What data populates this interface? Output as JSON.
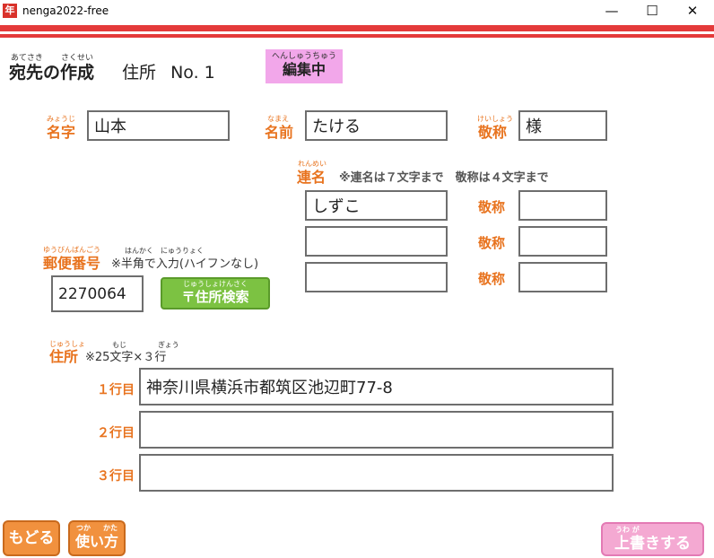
{
  "window": {
    "app_icon_text": "年",
    "title": "nenga2022-free",
    "minimize": "—",
    "maximize": "☐",
    "close": "✕"
  },
  "header": {
    "title": "宛先の作成",
    "title_ruby_1": "あてさき",
    "title_ruby_2": "さくせい",
    "address_label": "住所",
    "address_no": "No. 1",
    "badge_ruby": "へんしゅうちゅう",
    "badge_text": "編集中"
  },
  "name": {
    "family_label": "名字",
    "family_ruby": "みょうじ",
    "family_value": "山本",
    "given_label": "名前",
    "given_ruby": "なまえ",
    "given_value": "たける",
    "honorific_label": "敬称",
    "honorific_ruby": "けいしょう",
    "honorific_value": "様"
  },
  "joint": {
    "label": "連名",
    "ruby": "れんめい",
    "note": "※連名は７文字まで　敬称は４文字まで",
    "rows": [
      {
        "name": "しずこ",
        "honorific_label": "敬称",
        "honorific": ""
      },
      {
        "name": "",
        "honorific_label": "敬称",
        "honorific": ""
      },
      {
        "name": "",
        "honorific_label": "敬称",
        "honorific": ""
      }
    ]
  },
  "postal": {
    "label": "郵便番号",
    "ruby": "ゆうびんばんごう",
    "note": "※半角で入力(ハイフンなし)",
    "note_ruby_1": "はんかく",
    "note_ruby_2": "にゅうりょく",
    "value": "2270064",
    "search_ruby": "じゅうしょけんさく",
    "search_label": "〒住所検索"
  },
  "address": {
    "label": "住所",
    "ruby": "じゅうしょ",
    "note": "※25文字×３行",
    "note_ruby_1": "もじ",
    "note_ruby_2": "ぎょう",
    "line1_label": "１行目",
    "line1_value": "神奈川県横浜市都筑区池辺町77-8",
    "line2_label": "２行目",
    "line2_value": "",
    "line3_label": "３行目",
    "line3_value": ""
  },
  "footer": {
    "back_label": "もどる",
    "help_ruby_1": "つか",
    "help_ruby_2": "かた",
    "help_label": "使い方",
    "save_ruby": "うわ が",
    "save_label": "上書きする"
  }
}
